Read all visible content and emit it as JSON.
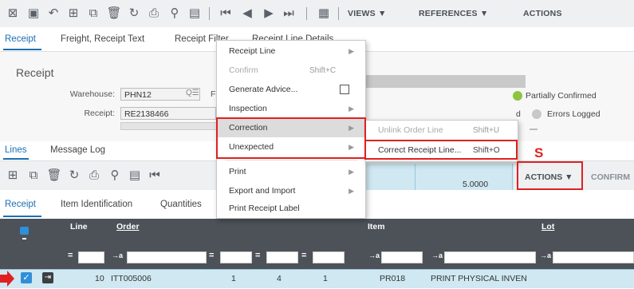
{
  "toolbar": {
    "icons": [
      "excel-export-icon",
      "save-icon",
      "undo-icon",
      "new-icon",
      "duplicate-icon",
      "delete-icon",
      "refresh-icon",
      "print-icon",
      "search-icon",
      "attachment-icon",
      "first-record-icon",
      "previous-record-icon",
      "next-record-icon",
      "last-record-icon",
      "calendar-icon"
    ],
    "views_label": "VIEWS ▼",
    "references_label": "REFERENCES ▼",
    "actions_label": "ACTIONS"
  },
  "tabs": [
    "Receipt",
    "Freight, Receipt Text",
    "Receipt Filter",
    "Receipt Line Details"
  ],
  "form": {
    "title": "Receipt",
    "warehouse_label": "Warehouse:",
    "warehouse_value": "PHN12",
    "receipt_label": "Receipt:",
    "receipt_value": "RE2138466",
    "f_fragment": "F",
    "d_fragment": "d",
    "status_partial": "Partially Confirmed",
    "status_errors": "Errors Logged"
  },
  "subtabs": [
    "Lines",
    "Message Log"
  ],
  "lines_toolbar": {
    "value": "5.0000",
    "actions_label": "ACTIONS ▼",
    "confirm_label": "CONFIRM"
  },
  "grid_tabs": [
    "Receipt",
    "Item Identification",
    "Quantities"
  ],
  "grid_header": {
    "line": "Line",
    "order": "Order",
    "item": "Item",
    "lot": "Lot"
  },
  "filter_ops": {
    "eq": "=",
    "arrow": "→a"
  },
  "row": {
    "line": "10",
    "order": "ITT005006",
    "q1": "1",
    "q2": "4",
    "q3": "1",
    "item": "PR018",
    "description": "PRINT PHYSICAL INVEN"
  },
  "context_menu": {
    "items": [
      {
        "label": "Receipt Line",
        "submenu": true
      },
      {
        "label": "Confirm",
        "shortcut": "Shift+C",
        "disabled": true
      },
      {
        "label": "Generate Advice...",
        "checkbox": true
      },
      {
        "label": "Inspection",
        "submenu": true
      },
      {
        "label": "Correction",
        "submenu": true
      },
      {
        "label": "Unexpected",
        "submenu": true
      },
      {
        "label": "Print",
        "submenu": true
      },
      {
        "label": "Export and Import",
        "submenu": true
      },
      {
        "label": "Print Receipt Label"
      }
    ]
  },
  "submenu": {
    "items": [
      {
        "label": "Unlink Order Line",
        "shortcut": "Shift+U",
        "disabled": true
      },
      {
        "label": "Correct Receipt Line...",
        "shortcut": "Shift+O"
      }
    ]
  },
  "annotation": {
    "letter": "S"
  },
  "colors": {
    "accent": "#1b6fb5",
    "annotation": "#e02020",
    "header": "#4c5258",
    "row_selected": "#cfe8f2"
  }
}
